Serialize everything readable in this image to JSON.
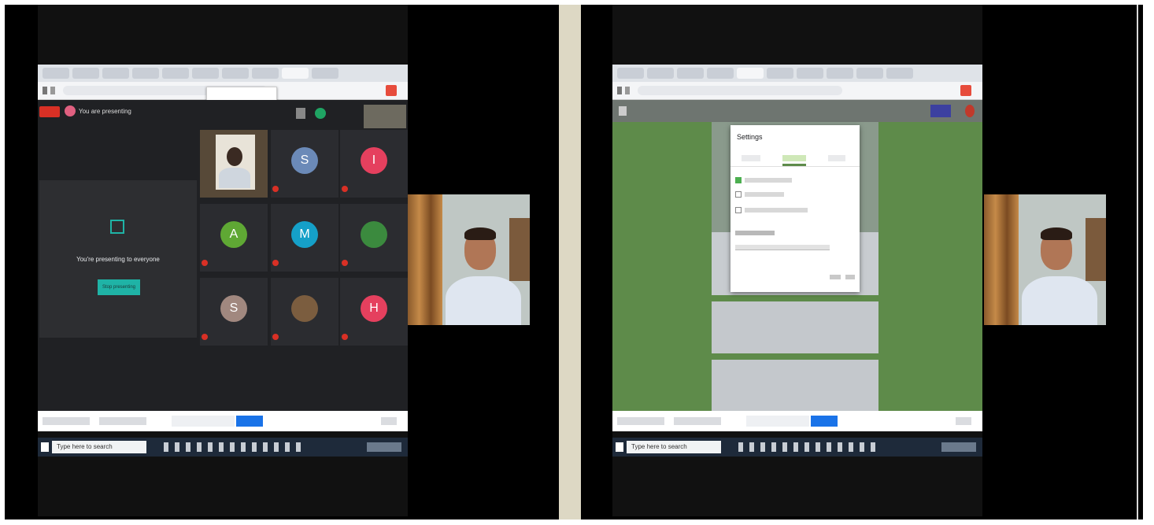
{
  "left_screen": {
    "tabs": [
      "",
      "",
      "",
      "",
      "",
      "",
      "",
      "",
      "",
      ""
    ],
    "url": "",
    "tooltip": {
      "title": "",
      "subtitle": ""
    },
    "meet": {
      "presenting_label": "You are presenting",
      "clock": "",
      "present_card": {
        "message": "You're presenting to everyone",
        "button": "Stop presenting"
      },
      "participants": [
        {
          "initial": "",
          "name": "",
          "color": "#4a4035",
          "is_video": true
        },
        {
          "initial": "S",
          "name": "",
          "color": "#6b8ab8"
        },
        {
          "initial": "I",
          "name": "",
          "color": "#e5405e"
        },
        {
          "initial": "A",
          "name": "",
          "color": "#5fa834"
        },
        {
          "initial": "M",
          "name": "",
          "color": "#15a0c8"
        },
        {
          "initial": "",
          "name": "",
          "color": "#3b8a3e"
        },
        {
          "initial": "S",
          "name": "",
          "color": "#a1887f"
        },
        {
          "initial": "",
          "name": "",
          "color": "#7b5d3f"
        },
        {
          "initial": "H",
          "name": "",
          "color": "#e5405e"
        }
      ]
    },
    "download_bar": {
      "item1": "",
      "item2": "",
      "sharing_text": "",
      "stop_sharing": "",
      "hide": "",
      "show_all": ""
    },
    "taskbar": {
      "search": "Type here to search",
      "time": ""
    }
  },
  "right_screen": {
    "tabs": [
      "",
      "",
      "",
      "",
      "",
      "",
      "",
      "",
      "",
      ""
    ],
    "url": "",
    "form_header": "",
    "settings_dialog": {
      "title": "Settings",
      "tabs": [
        "",
        "",
        ""
      ],
      "active_tab": 1,
      "options": [
        "",
        "",
        ""
      ],
      "section_label": "",
      "section_hint": "",
      "cancel": "",
      "save": ""
    },
    "download_bar": {
      "item1": "",
      "item2": "",
      "sharing_text": "",
      "stop_sharing": "",
      "hide": "",
      "show_all": ""
    },
    "taskbar": {
      "search": "Type here to search",
      "time": ""
    }
  },
  "webcams": [
    {
      "name": ""
    },
    {
      "name": ""
    }
  ],
  "colors": {
    "meet_dark": "#202124",
    "form_green": "#5e8b4a",
    "chrome_bar": "#dfe3e8",
    "taskbar": "#1e2a3a",
    "blue_button": "#1a73e8",
    "divider": "#ddd8c4"
  }
}
